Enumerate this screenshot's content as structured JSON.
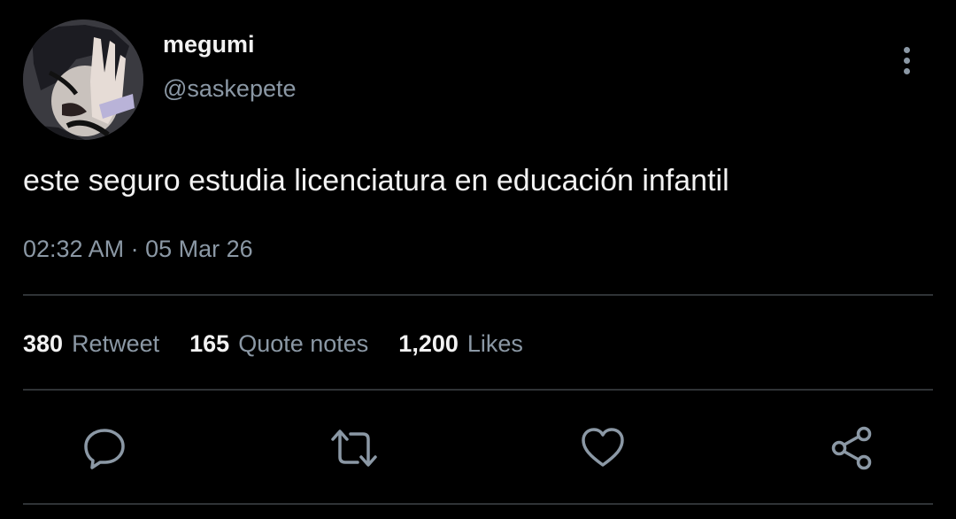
{
  "tweet": {
    "display_name": "megumi",
    "handle": "@saskepete",
    "text": "este seguro estudia licenciatura en educación infantil",
    "time": "02:32 AM",
    "separator": "·",
    "date": "05 Mar 26"
  },
  "stats": [
    {
      "count": "380",
      "label": "Retweet"
    },
    {
      "count": "165",
      "label": "Quote notes"
    },
    {
      "count": "1,200",
      "label": "Likes"
    }
  ],
  "actions": {
    "reply": "comment-icon",
    "retweet": "retweet-icon",
    "like": "heart-icon",
    "share": "share-icon"
  },
  "colors": {
    "background": "#000000",
    "primary_text": "#f2f2f2",
    "secondary_text": "#8b98a5",
    "divider": "#2f3336"
  }
}
